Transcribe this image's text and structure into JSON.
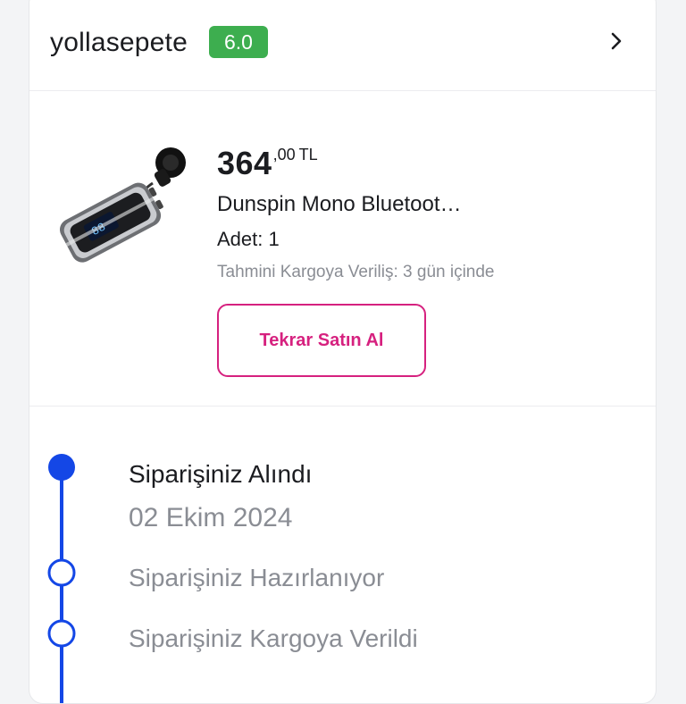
{
  "seller": {
    "name": "yollasepete",
    "score": "6.0",
    "score_color": "#3dae4f"
  },
  "product": {
    "price_int": "364",
    "price_dec": ",00",
    "currency": "TL",
    "title": "Dunspin Mono Bluetoot…",
    "quantity": "Adet: 1",
    "shipping_estimate": "Tahmini Kargoya Veriliş: 3 gün içinde",
    "buy_again_label": "Tekrar Satın Al",
    "image_icon": "earpiece-product-image"
  },
  "timeline": {
    "accent_color": "#1447e6",
    "steps": [
      {
        "label": "Siparişiniz Alındı",
        "date": "02 Ekim 2024",
        "done": true
      },
      {
        "label": "Siparişiniz Hazırlanıyor",
        "done": false
      },
      {
        "label": "Siparişiniz Kargoya Verildi",
        "done": false
      }
    ]
  }
}
